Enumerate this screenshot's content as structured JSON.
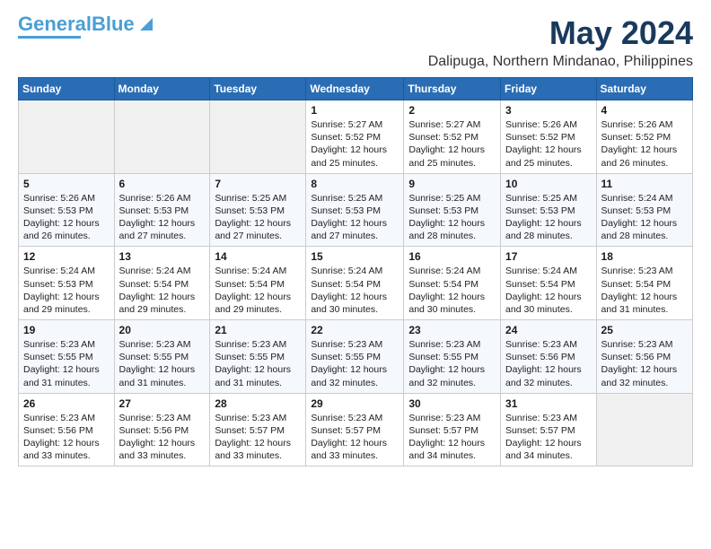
{
  "header": {
    "logo_general": "General",
    "logo_blue": "Blue",
    "title": "May 2024",
    "subtitle": "Dalipuga, Northern Mindanao, Philippines"
  },
  "calendar": {
    "headers": [
      "Sunday",
      "Monday",
      "Tuesday",
      "Wednesday",
      "Thursday",
      "Friday",
      "Saturday"
    ],
    "rows": [
      [
        {
          "day": "",
          "info": ""
        },
        {
          "day": "",
          "info": ""
        },
        {
          "day": "",
          "info": ""
        },
        {
          "day": "1",
          "info": "Sunrise: 5:27 AM\nSunset: 5:52 PM\nDaylight: 12 hours\nand 25 minutes."
        },
        {
          "day": "2",
          "info": "Sunrise: 5:27 AM\nSunset: 5:52 PM\nDaylight: 12 hours\nand 25 minutes."
        },
        {
          "day": "3",
          "info": "Sunrise: 5:26 AM\nSunset: 5:52 PM\nDaylight: 12 hours\nand 25 minutes."
        },
        {
          "day": "4",
          "info": "Sunrise: 5:26 AM\nSunset: 5:52 PM\nDaylight: 12 hours\nand 26 minutes."
        }
      ],
      [
        {
          "day": "5",
          "info": "Sunrise: 5:26 AM\nSunset: 5:53 PM\nDaylight: 12 hours\nand 26 minutes."
        },
        {
          "day": "6",
          "info": "Sunrise: 5:26 AM\nSunset: 5:53 PM\nDaylight: 12 hours\nand 27 minutes."
        },
        {
          "day": "7",
          "info": "Sunrise: 5:25 AM\nSunset: 5:53 PM\nDaylight: 12 hours\nand 27 minutes."
        },
        {
          "day": "8",
          "info": "Sunrise: 5:25 AM\nSunset: 5:53 PM\nDaylight: 12 hours\nand 27 minutes."
        },
        {
          "day": "9",
          "info": "Sunrise: 5:25 AM\nSunset: 5:53 PM\nDaylight: 12 hours\nand 28 minutes."
        },
        {
          "day": "10",
          "info": "Sunrise: 5:25 AM\nSunset: 5:53 PM\nDaylight: 12 hours\nand 28 minutes."
        },
        {
          "day": "11",
          "info": "Sunrise: 5:24 AM\nSunset: 5:53 PM\nDaylight: 12 hours\nand 28 minutes."
        }
      ],
      [
        {
          "day": "12",
          "info": "Sunrise: 5:24 AM\nSunset: 5:53 PM\nDaylight: 12 hours\nand 29 minutes."
        },
        {
          "day": "13",
          "info": "Sunrise: 5:24 AM\nSunset: 5:54 PM\nDaylight: 12 hours\nand 29 minutes."
        },
        {
          "day": "14",
          "info": "Sunrise: 5:24 AM\nSunset: 5:54 PM\nDaylight: 12 hours\nand 29 minutes."
        },
        {
          "day": "15",
          "info": "Sunrise: 5:24 AM\nSunset: 5:54 PM\nDaylight: 12 hours\nand 30 minutes."
        },
        {
          "day": "16",
          "info": "Sunrise: 5:24 AM\nSunset: 5:54 PM\nDaylight: 12 hours\nand 30 minutes."
        },
        {
          "day": "17",
          "info": "Sunrise: 5:24 AM\nSunset: 5:54 PM\nDaylight: 12 hours\nand 30 minutes."
        },
        {
          "day": "18",
          "info": "Sunrise: 5:23 AM\nSunset: 5:54 PM\nDaylight: 12 hours\nand 31 minutes."
        }
      ],
      [
        {
          "day": "19",
          "info": "Sunrise: 5:23 AM\nSunset: 5:55 PM\nDaylight: 12 hours\nand 31 minutes."
        },
        {
          "day": "20",
          "info": "Sunrise: 5:23 AM\nSunset: 5:55 PM\nDaylight: 12 hours\nand 31 minutes."
        },
        {
          "day": "21",
          "info": "Sunrise: 5:23 AM\nSunset: 5:55 PM\nDaylight: 12 hours\nand 31 minutes."
        },
        {
          "day": "22",
          "info": "Sunrise: 5:23 AM\nSunset: 5:55 PM\nDaylight: 12 hours\nand 32 minutes."
        },
        {
          "day": "23",
          "info": "Sunrise: 5:23 AM\nSunset: 5:55 PM\nDaylight: 12 hours\nand 32 minutes."
        },
        {
          "day": "24",
          "info": "Sunrise: 5:23 AM\nSunset: 5:56 PM\nDaylight: 12 hours\nand 32 minutes."
        },
        {
          "day": "25",
          "info": "Sunrise: 5:23 AM\nSunset: 5:56 PM\nDaylight: 12 hours\nand 32 minutes."
        }
      ],
      [
        {
          "day": "26",
          "info": "Sunrise: 5:23 AM\nSunset: 5:56 PM\nDaylight: 12 hours\nand 33 minutes."
        },
        {
          "day": "27",
          "info": "Sunrise: 5:23 AM\nSunset: 5:56 PM\nDaylight: 12 hours\nand 33 minutes."
        },
        {
          "day": "28",
          "info": "Sunrise: 5:23 AM\nSunset: 5:57 PM\nDaylight: 12 hours\nand 33 minutes."
        },
        {
          "day": "29",
          "info": "Sunrise: 5:23 AM\nSunset: 5:57 PM\nDaylight: 12 hours\nand 33 minutes."
        },
        {
          "day": "30",
          "info": "Sunrise: 5:23 AM\nSunset: 5:57 PM\nDaylight: 12 hours\nand 34 minutes."
        },
        {
          "day": "31",
          "info": "Sunrise: 5:23 AM\nSunset: 5:57 PM\nDaylight: 12 hours\nand 34 minutes."
        },
        {
          "day": "",
          "info": ""
        }
      ]
    ]
  }
}
